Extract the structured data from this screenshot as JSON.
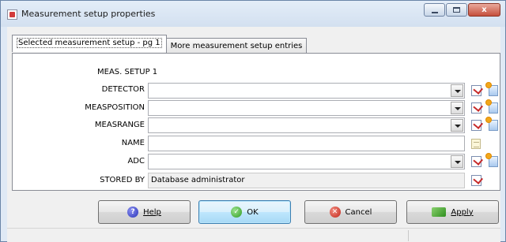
{
  "window": {
    "title": "Measurement setup properties",
    "controls": {
      "minimize": "minimize",
      "maximize": "maximize",
      "close": "x"
    }
  },
  "tabs": [
    {
      "label": "Selected measurement setup - pg 1",
      "active": true
    },
    {
      "label": "More measurement setup entries",
      "active": false
    }
  ],
  "form": {
    "heading": "MEAS. SETUP 1",
    "fields": [
      {
        "label": "DETECTOR",
        "type": "combo",
        "value": ""
      },
      {
        "label": "MEASPOSITION",
        "type": "combo",
        "value": ""
      },
      {
        "label": "MEASRANGE",
        "type": "combo",
        "value": ""
      },
      {
        "label": "NAME",
        "type": "text",
        "value": ""
      },
      {
        "label": "ADC",
        "type": "combo",
        "value": ""
      },
      {
        "label": "STORED BY",
        "type": "readonly",
        "value": "Database administrator"
      }
    ]
  },
  "buttons": {
    "help": {
      "label": "Help",
      "icon": "help-icon"
    },
    "ok": {
      "label": "OK",
      "icon": "check-icon"
    },
    "cancel": {
      "label": "Cancel",
      "icon": "cancel-icon"
    },
    "apply": {
      "label": "Apply",
      "icon": "apply-icon"
    }
  },
  "colors": {
    "accent": "#3c7fb1",
    "window_frame": "#dfe9f5"
  }
}
